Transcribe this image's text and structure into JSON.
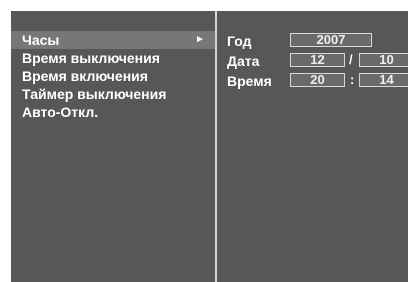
{
  "menu": {
    "items": [
      {
        "label": "Часы"
      },
      {
        "label": "Время выключения"
      },
      {
        "label": "Время включения"
      },
      {
        "label": "Таймер выключения"
      },
      {
        "label": "Авто-Откл."
      }
    ],
    "selected_arrow": "►"
  },
  "clock": {
    "year_label": "Год",
    "year_value": "2007",
    "date_label": "Дата",
    "date_day": "12",
    "date_sep": "/",
    "date_month": "10",
    "time_label": "Время",
    "time_hour": "20",
    "time_sep": ":",
    "time_minute": "14"
  },
  "colors": {
    "background": "#575757",
    "selected_row": "#777777",
    "text": "#ffffff",
    "divider": "#d4d4d4"
  }
}
